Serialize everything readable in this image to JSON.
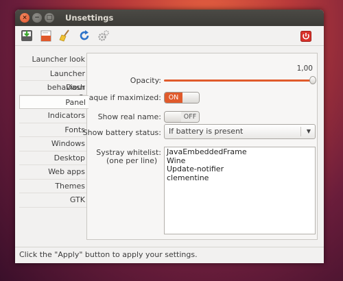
{
  "window": {
    "title": "Unsettings"
  },
  "titlebar": {
    "close_glyph": "×",
    "minimize_glyph": "−",
    "maximize_glyph": "□"
  },
  "toolbar": {
    "icons": [
      "save-icon",
      "open-icon",
      "clear-icon",
      "refresh-icon",
      "settings-icon",
      "quit-icon"
    ]
  },
  "sidebar": {
    "items": [
      {
        "label": "Launcher look"
      },
      {
        "label": "Launcher behaviour"
      },
      {
        "label": "Dash"
      },
      {
        "label": "Panel"
      },
      {
        "label": "Indicators"
      },
      {
        "label": "Fonts"
      },
      {
        "label": "Windows"
      },
      {
        "label": "Desktop"
      },
      {
        "label": "Web apps"
      },
      {
        "label": "Themes"
      },
      {
        "label": "GTK"
      }
    ],
    "active": "Panel"
  },
  "panel": {
    "opacity": {
      "label": "Opacity:",
      "value_text": "1,00",
      "value": 1.0
    },
    "opaque_if_maximized": {
      "label": "Opaque if maximized:",
      "state": "ON"
    },
    "show_real_name": {
      "label": "Show real name:",
      "state": "OFF"
    },
    "show_battery_status": {
      "label": "Show battery status:",
      "selected": "If battery is present"
    },
    "systray_whitelist": {
      "label_line1": "Systray whitelist:",
      "label_line2": "(one per line)",
      "entries": [
        "JavaEmbeddedFrame",
        "Wine",
        "Update-notifier",
        "clementine"
      ]
    }
  },
  "statusbar": {
    "text": "Click the \"Apply\" button to apply your settings."
  },
  "colors": {
    "accent": "#e05a2b",
    "window_bg": "#f2f1f0",
    "titlebar": "#3c3b37"
  }
}
